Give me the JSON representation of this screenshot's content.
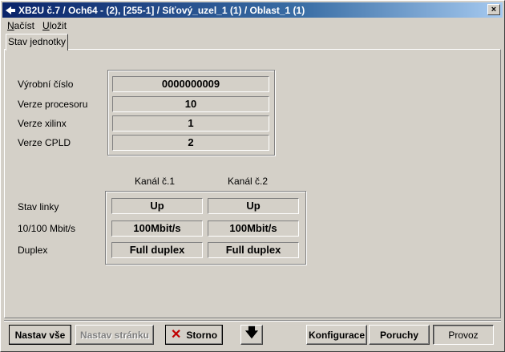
{
  "window": {
    "title": "XB2U č.7 / Och64 - (2), [255-1] / Síťový_uzel_1 (1) / Oblast_1 (1)",
    "close_label": "×"
  },
  "menu": [
    {
      "label": "Načíst",
      "mnemonic_index": 0
    },
    {
      "label": "Uložit",
      "mnemonic_index": 0
    }
  ],
  "tab": {
    "label": "Stav jednotky"
  },
  "unit_info": [
    {
      "label": "Výrobní číslo",
      "value": "0000000009"
    },
    {
      "label": "Verze procesoru",
      "value": "10"
    },
    {
      "label": "Verze xilinx",
      "value": "1"
    },
    {
      "label": "Verze CPLD",
      "value": "2"
    }
  ],
  "channels": {
    "headers": [
      "Kanál č.1",
      "Kanál č.2"
    ],
    "rows": [
      {
        "label": "Stav linky",
        "values": [
          "Up",
          "Up"
        ]
      },
      {
        "label": "10/100 Mbit/s",
        "values": [
          "100Mbit/s",
          "100Mbit/s"
        ]
      },
      {
        "label": "Duplex",
        "values": [
          "Full duplex",
          "Full duplex"
        ]
      }
    ]
  },
  "buttons": {
    "set_all": "Nastav vše",
    "set_page": "Nastav stránku",
    "cancel": "Storno",
    "arrow": "🡇",
    "config": "Konfigurace",
    "faults": "Poruchy",
    "operation": "Provoz"
  },
  "colors": {
    "title_start": "#0a246a",
    "title_end": "#a6caf0",
    "cancel_icon": "#c00000"
  }
}
